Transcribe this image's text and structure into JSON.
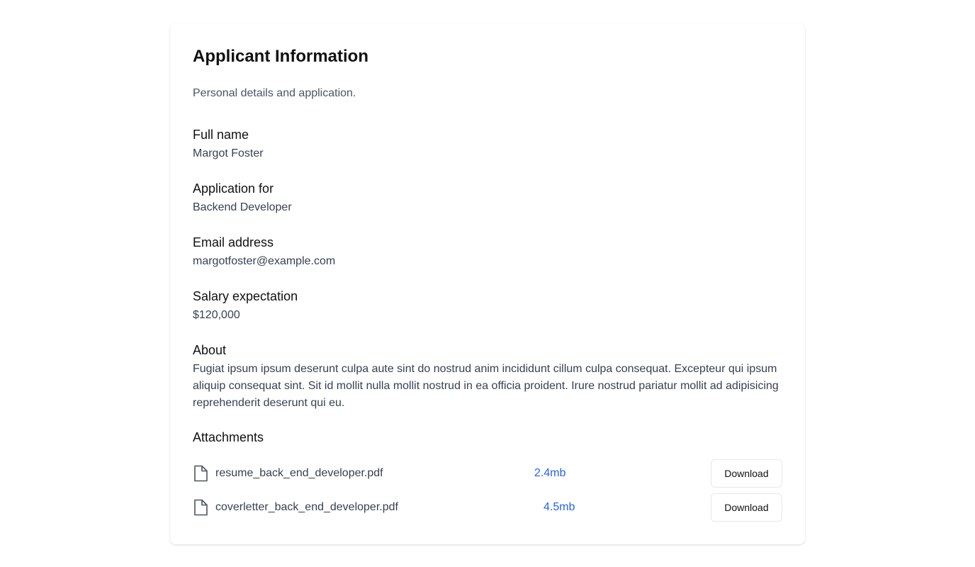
{
  "header": {
    "title": "Applicant Information",
    "subtitle": "Personal details and application."
  },
  "fields": [
    {
      "label": "Full name",
      "value": "Margot Foster"
    },
    {
      "label": "Application for",
      "value": "Backend Developer"
    },
    {
      "label": "Email address",
      "value": "margotfoster@example.com"
    },
    {
      "label": "Salary expectation",
      "value": "$120,000"
    },
    {
      "label": "About",
      "value": "Fugiat ipsum ipsum deserunt culpa aute sint do nostrud anim incididunt cillum culpa consequat. Excepteur qui ipsum aliquip consequat sint. Sit id mollit nulla mollit nostrud in ea officia proident. Irure nostrud pariatur mollit ad adipisicing reprehenderit deserunt qui eu."
    }
  ],
  "attachments": {
    "label": "Attachments",
    "files": [
      {
        "name": "resume_back_end_developer.pdf",
        "size": "2.4mb",
        "action": "Download",
        "icon": "document-icon"
      },
      {
        "name": "coverletter_back_end_developer.pdf",
        "size": "4.5mb",
        "action": "Download",
        "icon": "document-icon"
      }
    ]
  },
  "colors": {
    "accent": "#2563eb",
    "muted_text": "#4b5563",
    "value_text": "#374151",
    "border": "#e5e7eb"
  }
}
